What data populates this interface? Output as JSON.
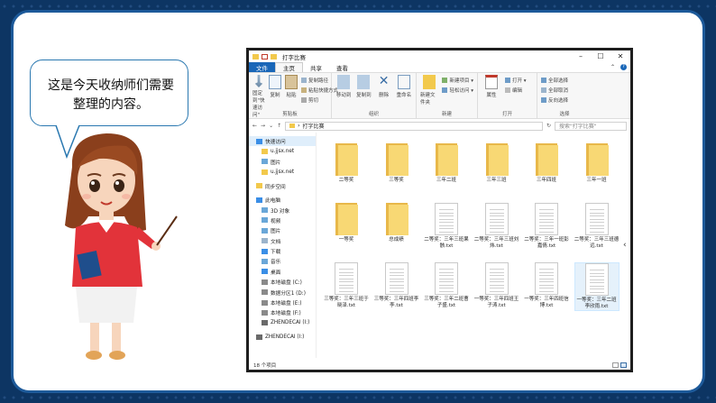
{
  "speech": {
    "text": "这是今天收纳师们需要整理的内容。"
  },
  "window": {
    "title": "打字比赛",
    "tabs": [
      "文件",
      "主页",
      "共享",
      "查看"
    ],
    "groups": [
      {
        "label": "剪贴板",
        "big": [
          "固定到\"快速访问\"",
          "复制",
          "粘贴"
        ],
        "small": [
          "复制路径",
          "粘贴快捷方式",
          "剪切"
        ]
      },
      {
        "label": "组织",
        "big": [
          "移动到",
          "复制到",
          "删除",
          "重命名"
        ],
        "small": []
      },
      {
        "label": "新建",
        "big": [
          "新建文件夹"
        ],
        "small": [
          "新建项目 ▾",
          "轻松访问 ▾"
        ]
      },
      {
        "label": "打开",
        "big": [
          "属性"
        ],
        "small": [
          "打开 ▾",
          "编辑"
        ]
      },
      {
        "label": "选择",
        "big": [],
        "small": [
          "全部选择",
          "全部取消",
          "反向选择"
        ]
      }
    ],
    "address": "打字比赛",
    "search_placeholder": "搜索\"打字比赛\"",
    "nav": [
      {
        "label": "快速访问",
        "icon": "star-icon",
        "indent": false,
        "sel": true
      },
      {
        "label": "u.jjsx.net",
        "icon": "pin-icon",
        "indent": true
      },
      {
        "label": "图片",
        "icon": "picture-icon",
        "indent": true
      },
      {
        "label": "u.jjsx.net",
        "icon": "pin-icon",
        "indent": true
      },
      {
        "label": "同步空间",
        "icon": "sync-folder-icon",
        "indent": false,
        "sep": true
      },
      {
        "label": "此电脑",
        "icon": "computer-icon",
        "indent": false,
        "sep": true
      },
      {
        "label": "3D 对象",
        "icon": "cube-icon",
        "indent": true
      },
      {
        "label": "视频",
        "icon": "video-icon",
        "indent": true
      },
      {
        "label": "图片",
        "icon": "picture-icon",
        "indent": true
      },
      {
        "label": "文档",
        "icon": "document-icon",
        "indent": true
      },
      {
        "label": "下载",
        "icon": "download-icon",
        "indent": true
      },
      {
        "label": "音乐",
        "icon": "music-icon",
        "indent": true
      },
      {
        "label": "桌面",
        "icon": "desktop-icon",
        "indent": true
      },
      {
        "label": "本地磁盘 (C:)",
        "icon": "drive-icon",
        "indent": true
      },
      {
        "label": "数据分区1 (D:)",
        "icon": "drive-icon",
        "indent": true
      },
      {
        "label": "本地磁盘 (E:)",
        "icon": "drive-icon",
        "indent": true
      },
      {
        "label": "本地磁盘 (F:)",
        "icon": "drive-icon",
        "indent": true
      },
      {
        "label": "ZHENDECAI (I:)",
        "icon": "usb-drive-icon",
        "indent": true
      },
      {
        "label": "ZHENDECAI (I:)",
        "icon": "usb-drive-icon",
        "indent": false,
        "sep": true
      }
    ],
    "files": [
      {
        "name": "二等奖",
        "type": "folder"
      },
      {
        "name": "三等奖",
        "type": "folder"
      },
      {
        "name": "三年二班",
        "type": "folder"
      },
      {
        "name": "三年三班",
        "type": "folder"
      },
      {
        "name": "三年四班",
        "type": "folder"
      },
      {
        "name": "三年一班",
        "type": "folder"
      },
      {
        "name": "一等奖",
        "type": "folder"
      },
      {
        "name": "总成绩",
        "type": "folder"
      },
      {
        "name": "二等奖：三年三班果骸.txt",
        "type": "txt"
      },
      {
        "name": "二等奖：三年三班刘炜.txt",
        "type": "txt"
      },
      {
        "name": "二等奖：三年一班彭嘉倩.txt",
        "type": "txt"
      },
      {
        "name": "二等奖：三年三班德远.txt",
        "type": "txt"
      },
      {
        "name": "三等奖：三年三班于晓泽.txt",
        "type": "txt"
      },
      {
        "name": "三等奖：三年四班李李.txt",
        "type": "txt"
      },
      {
        "name": "三等奖：三年二班曹子盛.txt",
        "type": "txt"
      },
      {
        "name": "一等奖：三年四班王子涛.txt",
        "type": "txt"
      },
      {
        "name": "一等奖：三年四班信博.txt",
        "type": "txt"
      },
      {
        "name": "一等奖：三年二班李欣雨.txt",
        "type": "txt",
        "sel": true
      }
    ],
    "status": "18 个项目"
  }
}
